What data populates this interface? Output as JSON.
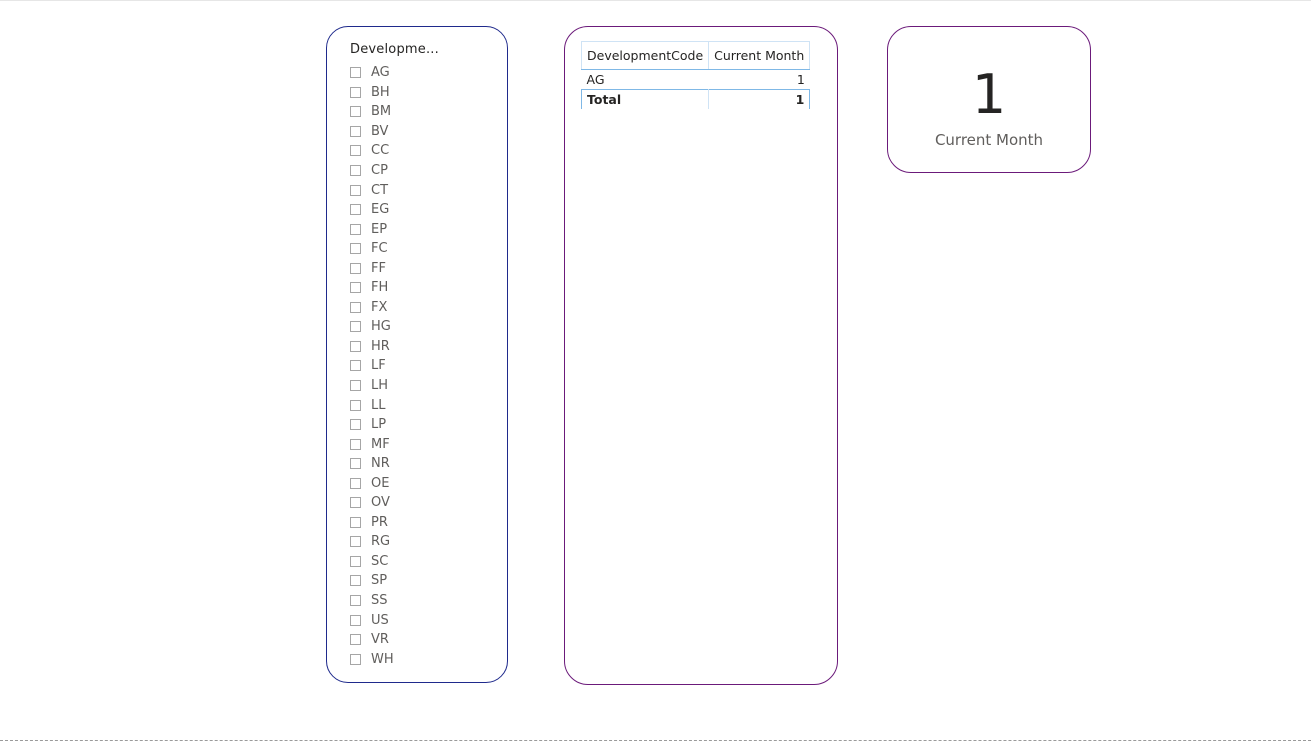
{
  "slicer": {
    "header": "Developme...",
    "items": [
      {
        "label": "AG"
      },
      {
        "label": "BH"
      },
      {
        "label": "BM"
      },
      {
        "label": "BV"
      },
      {
        "label": "CC"
      },
      {
        "label": "CP"
      },
      {
        "label": "CT"
      },
      {
        "label": "EG"
      },
      {
        "label": "EP"
      },
      {
        "label": "FC"
      },
      {
        "label": "FF"
      },
      {
        "label": "FH"
      },
      {
        "label": "FX"
      },
      {
        "label": "HG"
      },
      {
        "label": "HR"
      },
      {
        "label": "LF"
      },
      {
        "label": "LH"
      },
      {
        "label": "LL"
      },
      {
        "label": "LP"
      },
      {
        "label": "MF"
      },
      {
        "label": "NR"
      },
      {
        "label": "OE"
      },
      {
        "label": "OV"
      },
      {
        "label": "PR"
      },
      {
        "label": "RG"
      },
      {
        "label": "SC"
      },
      {
        "label": "SP"
      },
      {
        "label": "SS"
      },
      {
        "label": "US"
      },
      {
        "label": "VR"
      },
      {
        "label": "WH"
      }
    ]
  },
  "table": {
    "columns": [
      "DevelopmentCode",
      "Current Month"
    ],
    "rows": [
      {
        "code": "AG",
        "value": "1"
      }
    ],
    "total": {
      "label": "Total",
      "value": "1"
    }
  },
  "card": {
    "value": "1",
    "label": "Current Month"
  },
  "colors": {
    "slicer_border": "#1f2a8c",
    "card_border": "#6b1a7a",
    "table_accent": "#7fb8e6"
  }
}
